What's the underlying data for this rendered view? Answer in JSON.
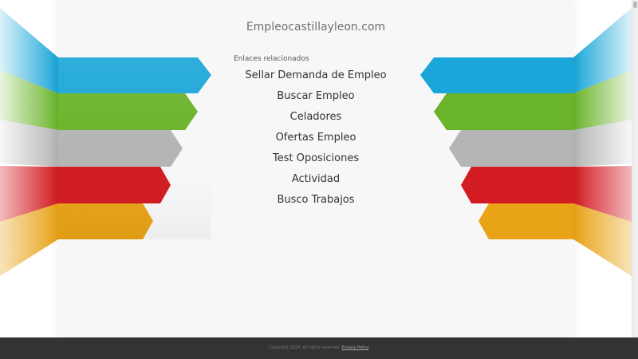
{
  "site": {
    "title": "Empleocastillayleon.com"
  },
  "related": {
    "heading": "Enlaces relacionados",
    "links": [
      "Sellar Demanda de Empleo",
      "Buscar Empleo",
      "Celadores",
      "Ofertas Empleo",
      "Test Oposiciones",
      "Actividad",
      "Busco Trabajos"
    ]
  },
  "footer": {
    "copyright": "Copyright 2020. All rights reserved.",
    "privacy_label": "Privacy Policy"
  },
  "colors": {
    "ribbon_blue": "#1aa6d8",
    "ribbon_green": "#6ab42a",
    "ribbon_gray": "#b5b5b5",
    "ribbon_red": "#d21b22",
    "ribbon_orange": "#e8a317",
    "content_bg": "#f7f7f7",
    "footer_bg": "#333333"
  }
}
